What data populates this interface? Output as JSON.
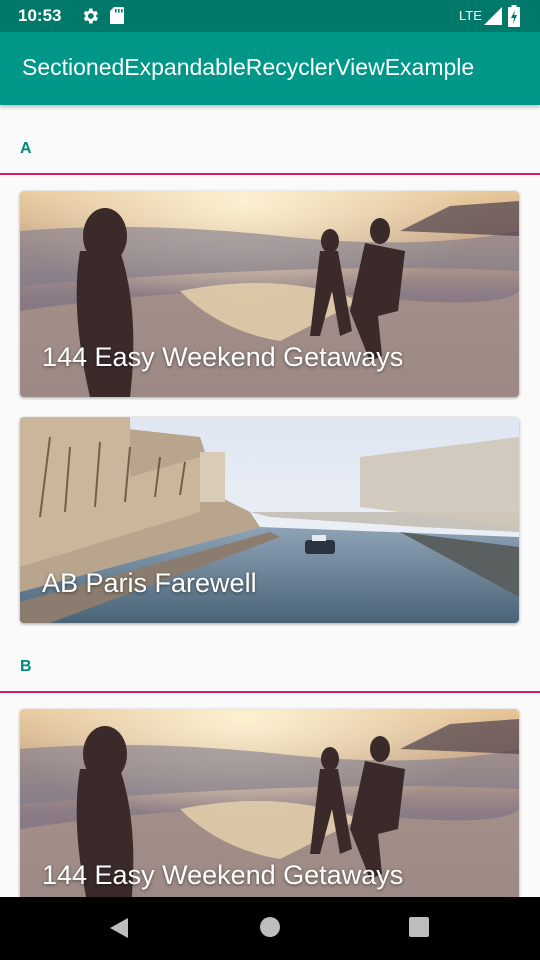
{
  "status_bar": {
    "time": "10:53",
    "network": "LTE",
    "icons": [
      "settings-gear-icon",
      "sd-card-icon",
      "signal-icon",
      "battery-charging-icon"
    ]
  },
  "app_bar": {
    "title": "SectionedExpandableRecyclerViewExample",
    "color": "#009688"
  },
  "sections": [
    {
      "letter": "A",
      "items": [
        {
          "title": "144 Easy Weekend Getaways",
          "image": "beach-runners-photo"
        },
        {
          "title": "AB Paris Farewell",
          "image": "paris-seine-photo"
        }
      ]
    },
    {
      "letter": "B",
      "items": [
        {
          "title": "144 Easy Weekend Getaways",
          "image": "beach-runners-photo"
        }
      ]
    }
  ],
  "nav_bar": {
    "icons": [
      "back-icon",
      "home-icon",
      "recents-icon"
    ]
  },
  "colors": {
    "status_bar": "#00796b",
    "accent_text": "#00897b",
    "divider": "#d81b60"
  }
}
